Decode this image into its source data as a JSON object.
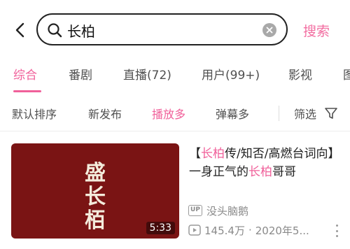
{
  "search": {
    "query": "长柏",
    "submit_label": "搜索"
  },
  "tabs": [
    {
      "label": "综合",
      "active": true
    },
    {
      "label": "番剧"
    },
    {
      "label": "直播(72)"
    },
    {
      "label": "用户(99+)"
    },
    {
      "label": "影视"
    },
    {
      "label": "图"
    }
  ],
  "filters": [
    {
      "label": "默认排序"
    },
    {
      "label": "新发布"
    },
    {
      "label": "播放多",
      "active": true
    },
    {
      "label": "弹幕多"
    },
    {
      "label": "筛选"
    }
  ],
  "results": [
    {
      "title_parts": [
        "【",
        "长柏",
        "传/知否/高燃台词向】一身正气的",
        "长柏",
        "哥哥"
      ],
      "thumbnail_text": "盛长栢",
      "duration": "5:33",
      "uploader_badge": "UP",
      "uploader": "没头脑鹅",
      "views": "145.4万",
      "date": "2020年5..."
    }
  ],
  "colors": {
    "accent": "#f0609a",
    "thumbnail_bg": "#7a1414"
  }
}
